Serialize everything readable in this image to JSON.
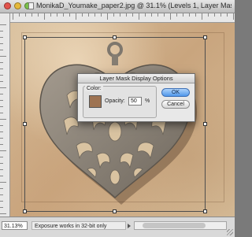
{
  "window": {
    "title": "MonikaD_Youmake_paper2.jpg @ 31.1% (Levels 1, Layer Mask/8) *"
  },
  "statusbar": {
    "zoom": "31.13%",
    "info": "Exposure works in 32-bit only"
  },
  "dialog": {
    "title": "Layer Mask Display Options",
    "group_label": "Color:",
    "opacity_label": "Opacity:",
    "opacity_value": "50",
    "percent": "%",
    "ok_label": "OK",
    "cancel_label": "Cancel",
    "swatch_color": "#9e7352"
  },
  "icons": {
    "window_close": "red-circle",
    "window_minimize": "yellow-circle",
    "window_zoom": "green-circle",
    "document": "document-icon",
    "status_menu": "triangle-right-icon",
    "resize": "resize-grip-icon"
  }
}
